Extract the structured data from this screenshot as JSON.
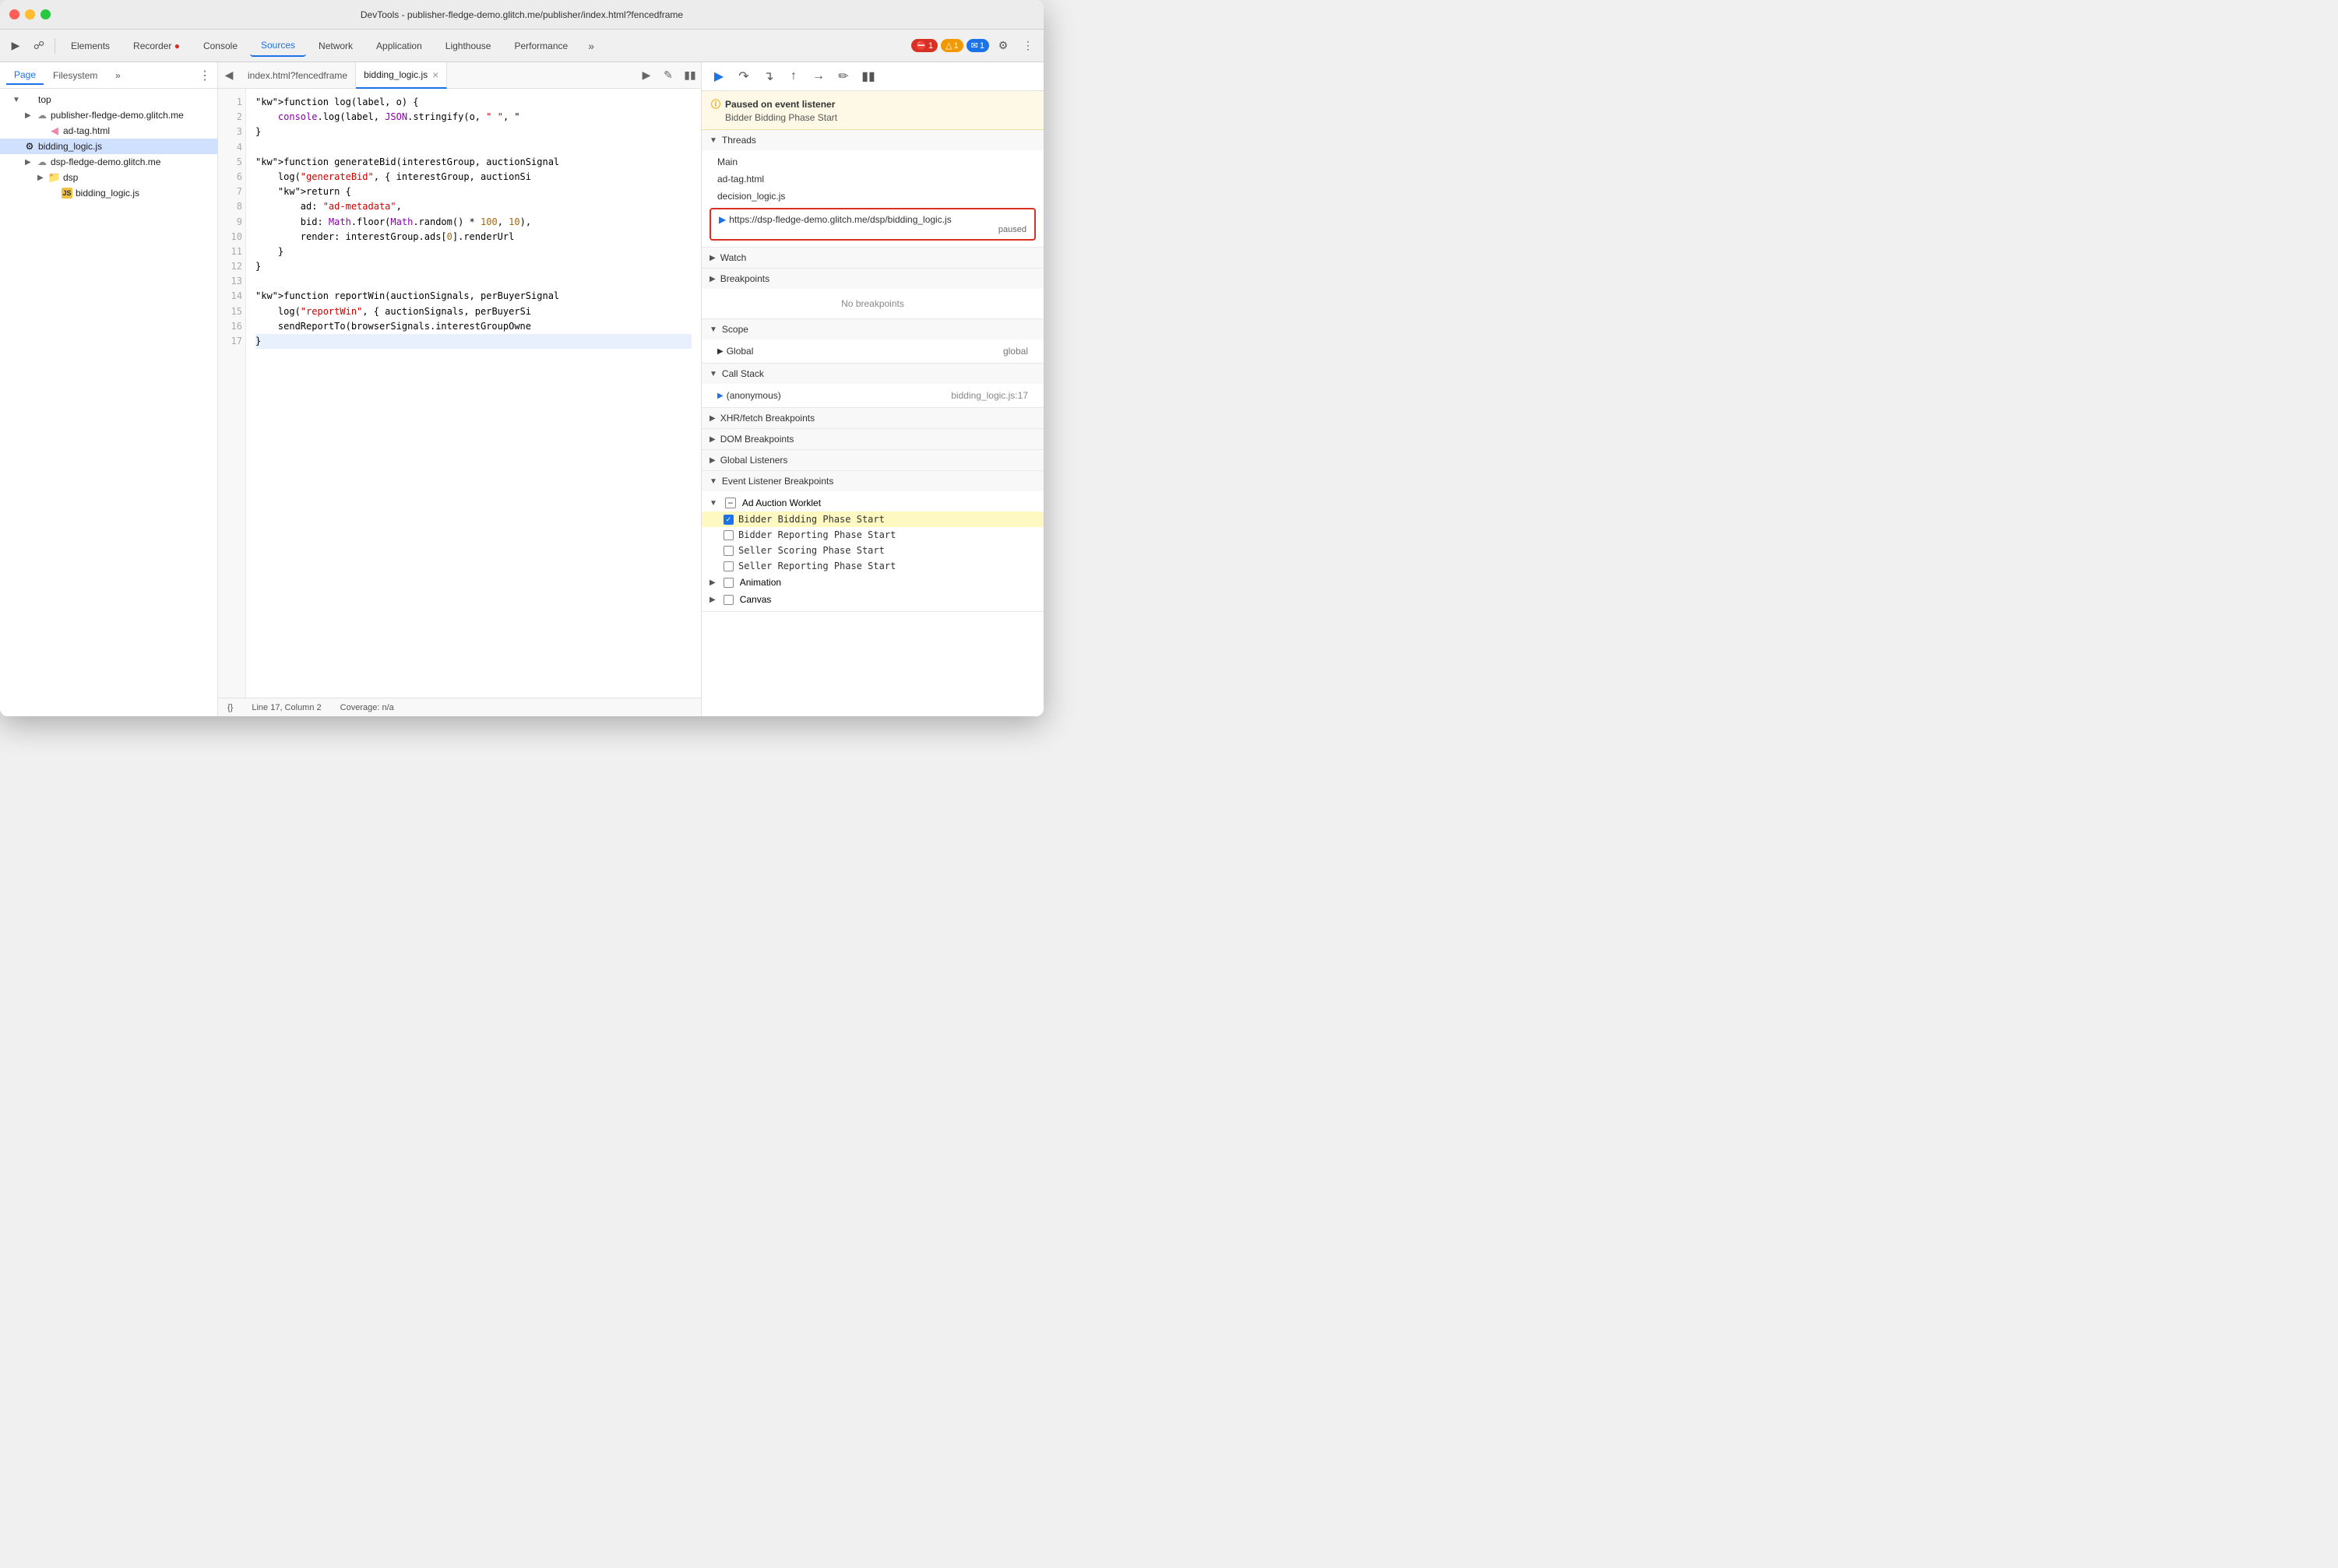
{
  "window": {
    "title": "DevTools - publisher-fledge-demo.glitch.me/publisher/index.html?fencedframe"
  },
  "toolbar": {
    "tabs": [
      {
        "id": "elements",
        "label": "Elements",
        "active": false
      },
      {
        "id": "recorder",
        "label": "Recorder 🔴",
        "active": false
      },
      {
        "id": "console",
        "label": "Console",
        "active": false
      },
      {
        "id": "sources",
        "label": "Sources",
        "active": true
      },
      {
        "id": "network",
        "label": "Network",
        "active": false
      },
      {
        "id": "application",
        "label": "Application",
        "active": false
      },
      {
        "id": "lighthouse",
        "label": "Lighthouse",
        "active": false
      },
      {
        "id": "performance",
        "label": "Performance",
        "active": false
      }
    ],
    "badges": {
      "error": "1",
      "warning": "1",
      "message": "1"
    }
  },
  "sidebar": {
    "tabs": [
      "Page",
      "Filesystem"
    ],
    "active_tab": "Page",
    "tree": [
      {
        "level": 0,
        "type": "arrow-down",
        "icon": "none",
        "label": "top"
      },
      {
        "level": 1,
        "type": "arrow-right",
        "icon": "cloud",
        "label": "publisher-fledge-demo.glitch.me"
      },
      {
        "level": 2,
        "type": "none",
        "icon": "html",
        "label": "ad-tag.html"
      },
      {
        "level": 1,
        "type": "none",
        "icon": "gear",
        "label": "bidding_logic.js",
        "selected": true
      },
      {
        "level": 1,
        "type": "arrow-right",
        "icon": "cloud",
        "label": "dsp-fledge-demo.glitch.me"
      },
      {
        "level": 2,
        "type": "arrow-right",
        "icon": "folder",
        "label": "dsp"
      },
      {
        "level": 3,
        "type": "none",
        "icon": "js",
        "label": "bidding_logic.js"
      }
    ]
  },
  "editor": {
    "tabs": [
      {
        "id": "index",
        "label": "index.html?fencedframe",
        "active": false,
        "closeable": false
      },
      {
        "id": "bidding",
        "label": "bidding_logic.js",
        "active": true,
        "closeable": true
      }
    ],
    "lines": [
      {
        "num": 1,
        "code": "function log(label, o) {",
        "highlight": false
      },
      {
        "num": 2,
        "code": "    console.log(label, JSON.stringify(o, \" \", \"",
        "highlight": false
      },
      {
        "num": 3,
        "code": "}",
        "highlight": false
      },
      {
        "num": 4,
        "code": "",
        "highlight": false
      },
      {
        "num": 5,
        "code": "function generateBid(interestGroup, auctionSignal",
        "highlight": false
      },
      {
        "num": 6,
        "code": "    log(\"generateBid\", { interestGroup, auctionSi",
        "highlight": false
      },
      {
        "num": 7,
        "code": "    return {",
        "highlight": false
      },
      {
        "num": 8,
        "code": "        ad: \"ad-metadata\",",
        "highlight": false
      },
      {
        "num": 9,
        "code": "        bid: Math.floor(Math.random() * 100, 10),",
        "highlight": false
      },
      {
        "num": 10,
        "code": "        render: interestGroup.ads[0].renderUrl",
        "highlight": false
      },
      {
        "num": 11,
        "code": "    }",
        "highlight": false
      },
      {
        "num": 12,
        "code": "}",
        "highlight": false
      },
      {
        "num": 13,
        "code": "",
        "highlight": false
      },
      {
        "num": 14,
        "code": "function reportWin(auctionSignals, perBuyerSignal",
        "highlight": false
      },
      {
        "num": 15,
        "code": "    log(\"reportWin\", { auctionSignals, perBuyerSi",
        "highlight": false
      },
      {
        "num": 16,
        "code": "    sendReportTo(browserSignals.interestGroupOwne",
        "highlight": false
      },
      {
        "num": 17,
        "code": "}",
        "highlight": true
      }
    ],
    "status": {
      "line": "Line 17, Column 2",
      "coverage": "Coverage: n/a"
    }
  },
  "debugger": {
    "paused": {
      "title": "Paused on event listener",
      "subtitle": "Bidder Bidding Phase Start"
    },
    "threads": {
      "label": "Threads",
      "items": [
        {
          "name": "Main",
          "active": false
        },
        {
          "name": "ad-tag.html",
          "active": false
        },
        {
          "name": "decision_logic.js",
          "active": false
        },
        {
          "name": "https://dsp-fledge-demo.glitch.me/dsp/bidding_logic.js",
          "active": true,
          "status": "paused",
          "highlighted": true
        }
      ]
    },
    "watch": {
      "label": "Watch"
    },
    "breakpoints": {
      "label": "Breakpoints",
      "empty_text": "No breakpoints"
    },
    "scope": {
      "label": "Scope",
      "items": [
        {
          "key": "Global",
          "value": "global",
          "expanded": false
        }
      ]
    },
    "call_stack": {
      "label": "Call Stack",
      "items": [
        {
          "name": "(anonymous)",
          "location": "bidding_logic.js:17",
          "active": true
        }
      ]
    },
    "xhr_breakpoints": {
      "label": "XHR/fetch Breakpoints"
    },
    "dom_breakpoints": {
      "label": "DOM Breakpoints"
    },
    "global_listeners": {
      "label": "Global Listeners"
    },
    "event_listener_breakpoints": {
      "label": "Event Listener Breakpoints",
      "groups": [
        {
          "name": "Ad Auction Worklet",
          "expanded": true,
          "items": [
            {
              "label": "Bidder Bidding Phase Start",
              "checked": true,
              "highlighted": true
            },
            {
              "label": "Bidder Reporting Phase Start",
              "checked": false
            },
            {
              "label": "Seller Scoring Phase Start",
              "checked": false
            },
            {
              "label": "Seller Reporting Phase Start",
              "checked": false
            }
          ]
        },
        {
          "name": "Animation",
          "expanded": false
        },
        {
          "name": "Canvas",
          "expanded": false
        }
      ]
    }
  }
}
